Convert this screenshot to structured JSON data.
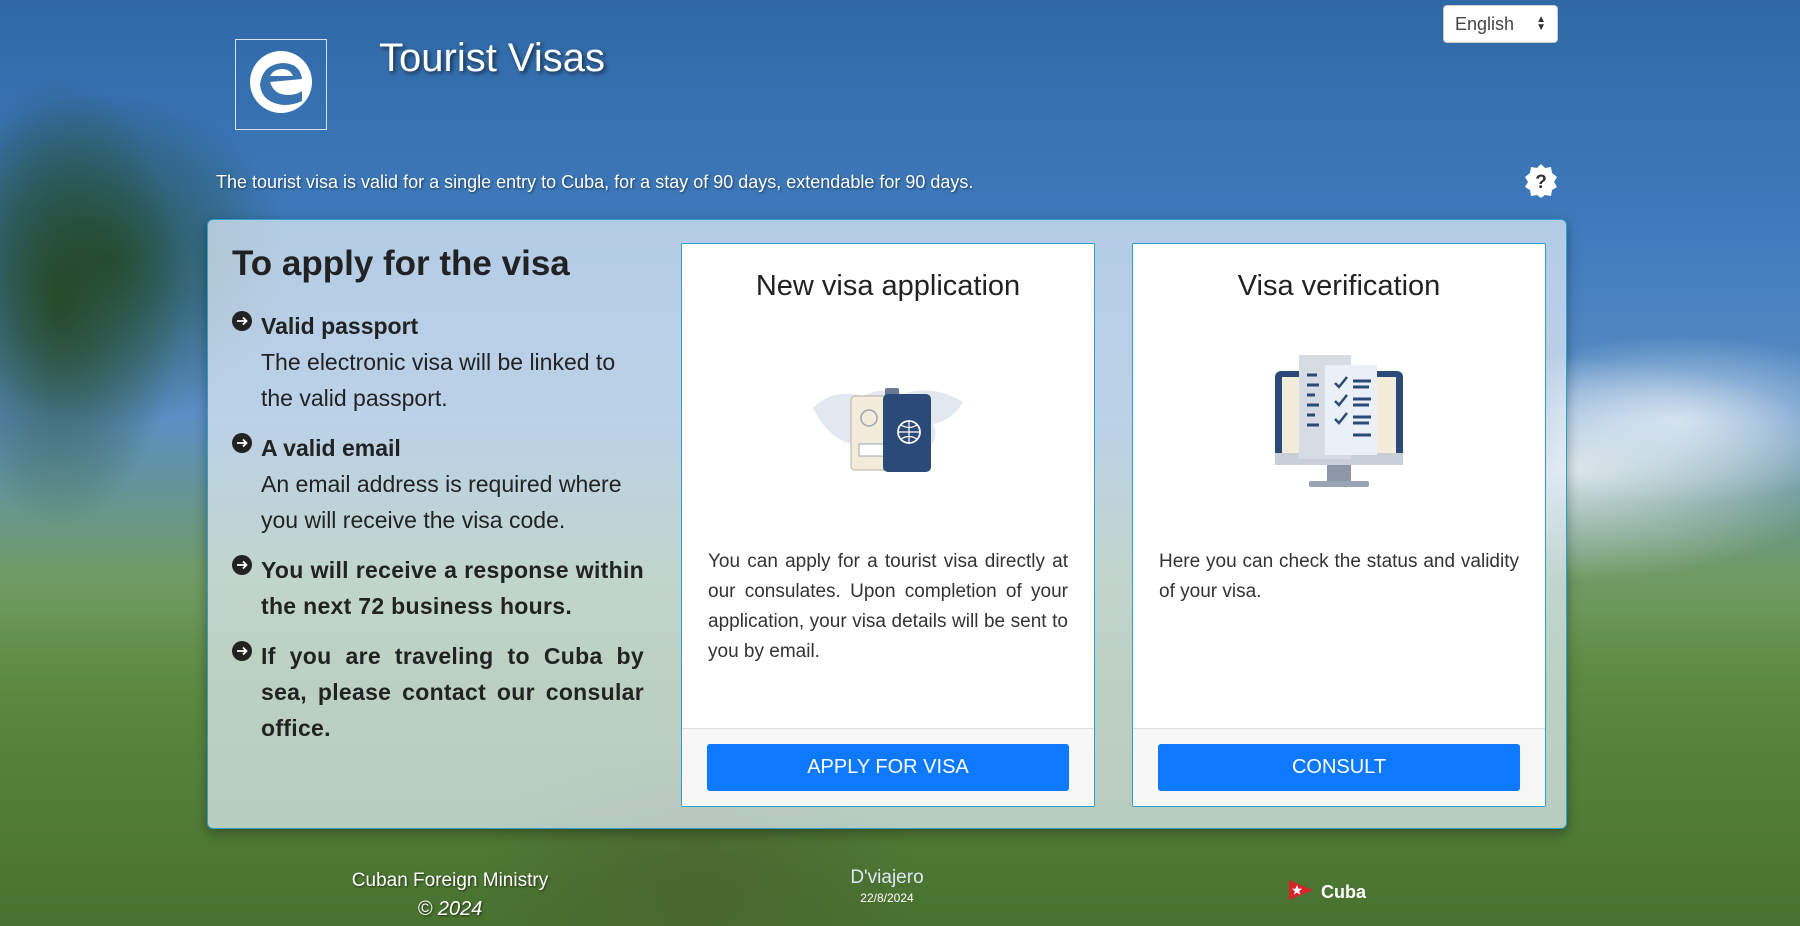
{
  "header": {
    "title": "Tourist Visas",
    "language": "English",
    "intro": "The tourist visa is valid for a single entry to Cuba, for a stay of 90 days, extendable for 90 days."
  },
  "requirements": {
    "heading": "To apply for the visa",
    "items": [
      {
        "title": "Valid passport",
        "text": "The electronic visa will be linked to the valid passport."
      },
      {
        "title": "A valid email",
        "text": "An email address is required where you will receive the visa code."
      },
      {
        "bold": "You will receive a response within the next 72 business hours."
      },
      {
        "bold": "If you are traveling to Cuba by sea, please contact our consular office."
      }
    ]
  },
  "cards": {
    "new_application": {
      "title": "New visa application",
      "description": "You can apply for a tourist visa directly at our consulates. Upon completion of your application, your visa details will be sent to you by email.",
      "button": "APPLY FOR VISA"
    },
    "verification": {
      "title": "Visa verification",
      "description": "Here you can check the status and validity of your visa.",
      "button": "CONSULT"
    }
  },
  "footer": {
    "ministry": "Cuban Foreign Ministry",
    "copyright": "© 2024",
    "brand": "D'viajero",
    "date": "22/8/2024",
    "cuba": "Cuba"
  },
  "icons": {
    "logo": "e-logo-icon",
    "help": "question-badge-icon",
    "bullet": "arrow-circle-icon",
    "passport": "passport-map-icon",
    "monitor": "monitor-checklist-icon",
    "flag": "cuba-star-icon"
  },
  "colors": {
    "primary_button": "#0d79ff",
    "card_border": "#2f9fd0"
  }
}
